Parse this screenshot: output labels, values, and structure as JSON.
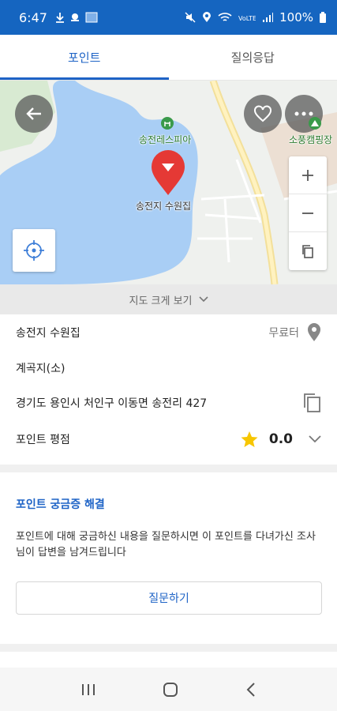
{
  "status_bar": {
    "time": "6:47",
    "battery": "100%",
    "icons_left": [
      "download-icon",
      "notification-icon",
      "image-icon"
    ],
    "icons_right": [
      "mute-icon",
      "location-icon",
      "wifi-icon",
      "volte-icon",
      "signal-icon",
      "battery-icon"
    ]
  },
  "tabs": [
    {
      "label": "포인트",
      "active": true
    },
    {
      "label": "질의응답",
      "active": false
    }
  ],
  "map": {
    "place_label": "송전지 수원집",
    "poi_1": "송전레스피아",
    "poi_2": "소풍캠핑장",
    "icons": [
      "back-arrow-icon",
      "heart-icon",
      "more-icon",
      "location-pin-icon",
      "zoom-in-icon",
      "zoom-out-icon",
      "copy-icon",
      "crosshair-icon"
    ]
  },
  "expand_map": {
    "label": "지도 크게 보기"
  },
  "point_info": {
    "name": "송전지 수원집",
    "fee": "무료터",
    "category": "계곡지(소)",
    "address": "경기도 용인시 처인구 이동면 송전리 427",
    "rating_label": "포인트 평점",
    "rating_value": "0.0"
  },
  "faq": {
    "title": "포인트 궁금증 해결",
    "description": "포인트에 대해 궁금하신 내용을 질문하시면 이 포인트를 다녀가신 조사님이 답변을 남겨드립니다",
    "ask_button": "질문하기"
  },
  "colors": {
    "accent": "#1e63c6",
    "status_bar": "#1565c0",
    "water": "#a9cef5",
    "pin": "#e53935",
    "star": "#f7c600"
  }
}
